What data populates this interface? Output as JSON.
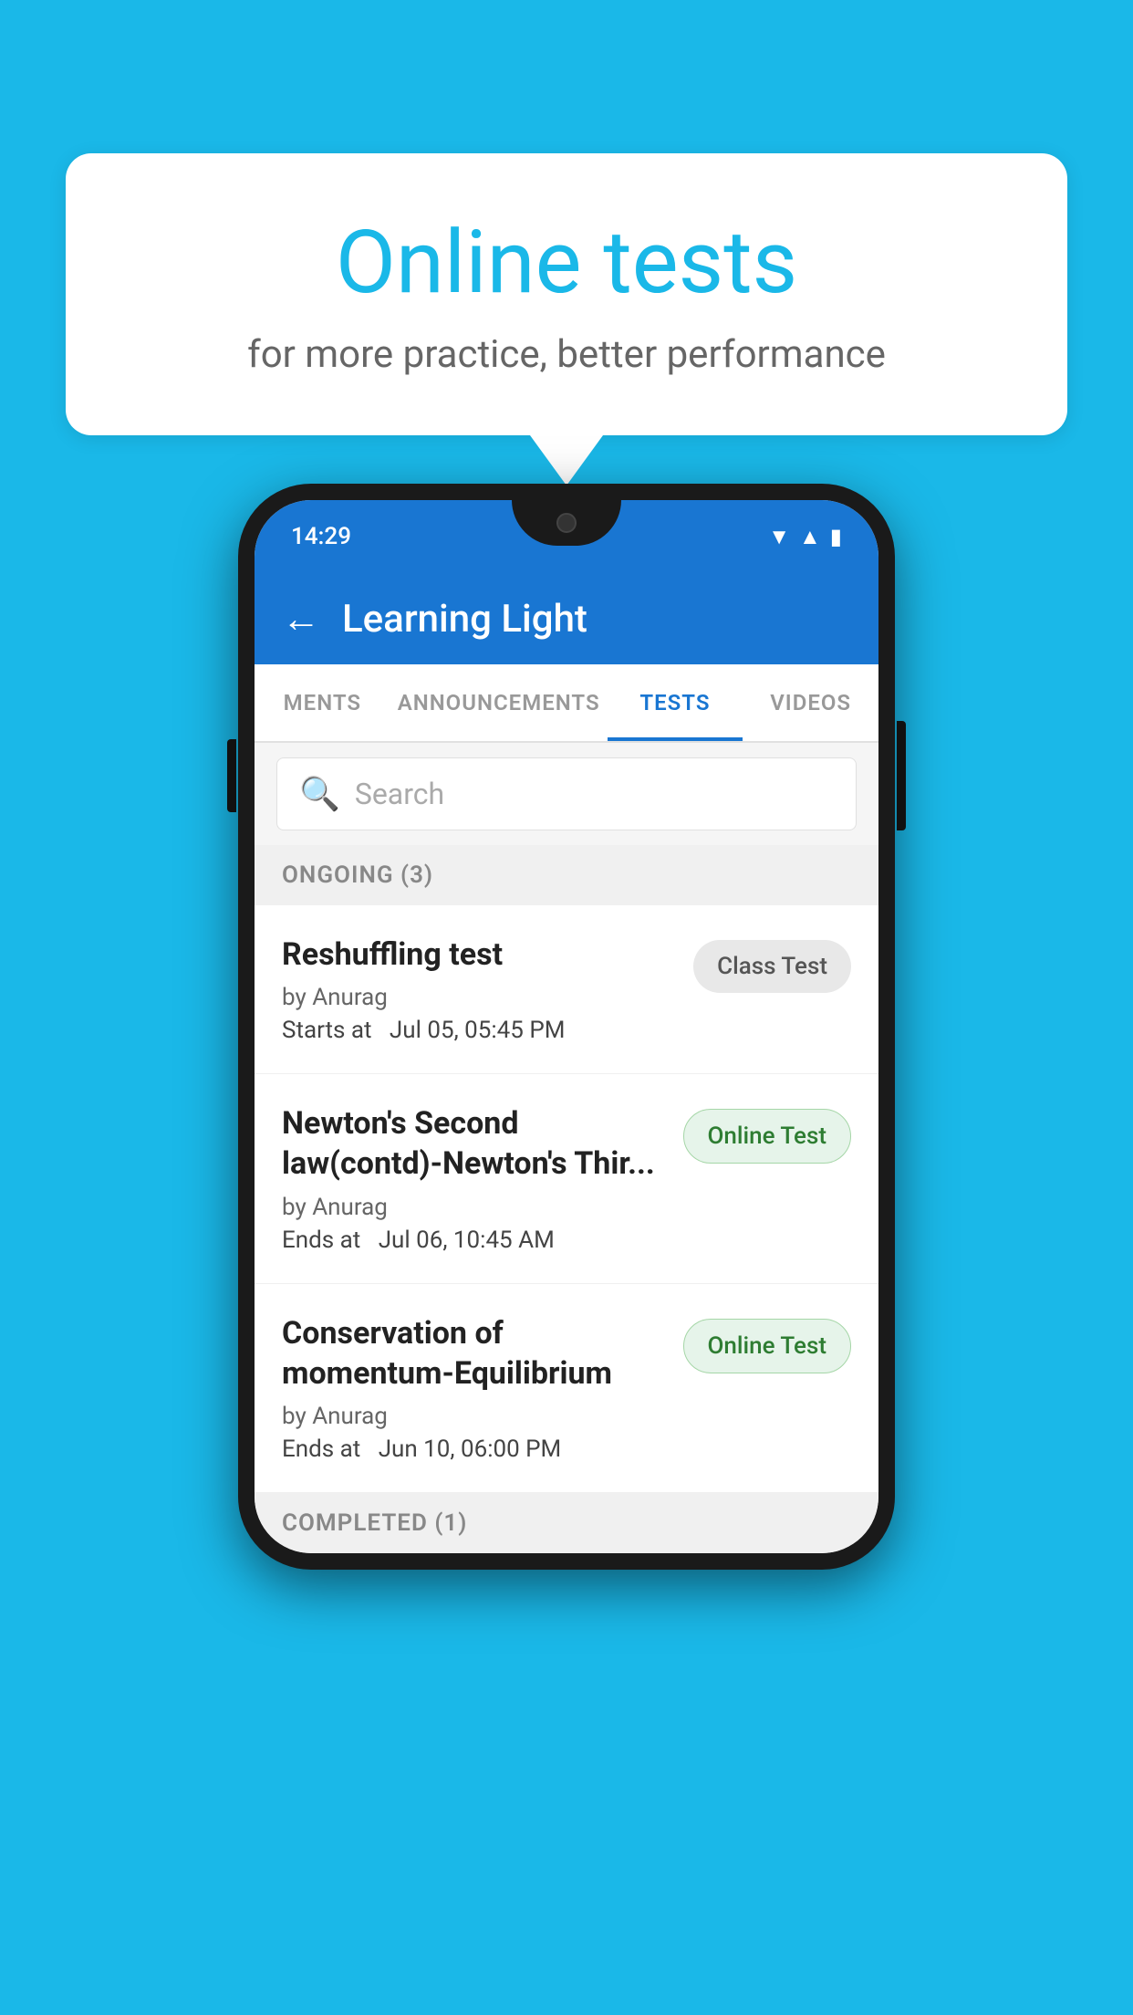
{
  "background_color": "#1ab8e8",
  "bubble": {
    "title": "Online tests",
    "subtitle": "for more practice, better performance"
  },
  "phone": {
    "status": {
      "time": "14:29"
    },
    "app_bar": {
      "title": "Learning Light",
      "back_label": "←"
    },
    "tabs": [
      {
        "label": "MENTS",
        "active": false
      },
      {
        "label": "ANNOUNCEMENTS",
        "active": false
      },
      {
        "label": "TESTS",
        "active": true
      },
      {
        "label": "VIDEOS",
        "active": false
      }
    ],
    "search": {
      "placeholder": "Search"
    },
    "sections": [
      {
        "header": "ONGOING (3)",
        "items": [
          {
            "title": "Reshuffling test",
            "author": "by Anurag",
            "date_label": "Starts at",
            "date_value": "Jul 05, 05:45 PM",
            "badge": "Class Test",
            "badge_type": "class"
          },
          {
            "title": "Newton's Second law(contd)-Newton's Thir...",
            "author": "by Anurag",
            "date_label": "Ends at",
            "date_value": "Jul 06, 10:45 AM",
            "badge": "Online Test",
            "badge_type": "online"
          },
          {
            "title": "Conservation of momentum-Equilibrium",
            "author": "by Anurag",
            "date_label": "Ends at",
            "date_value": "Jun 10, 06:00 PM",
            "badge": "Online Test",
            "badge_type": "online"
          }
        ]
      }
    ],
    "completed_header": "COMPLETED (1)"
  }
}
